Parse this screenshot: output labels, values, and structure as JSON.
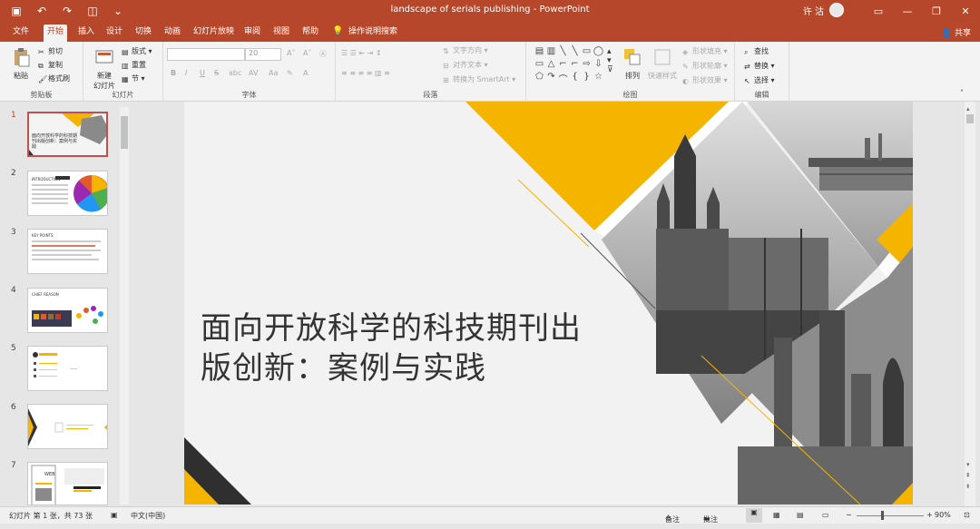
{
  "window": {
    "title": "landscape of serials publishing  -  PowerPoint",
    "user": "许 沽",
    "qat": [
      "save-icon",
      "undo-icon",
      "redo-icon",
      "present-icon",
      "more-icon"
    ]
  },
  "tabs": [
    {
      "label": "文件"
    },
    {
      "label": "开始"
    },
    {
      "label": "插入"
    },
    {
      "label": "设计"
    },
    {
      "label": "切换"
    },
    {
      "label": "动画"
    },
    {
      "label": "幻灯片放映"
    },
    {
      "label": "审阅"
    },
    {
      "label": "视图"
    },
    {
      "label": "帮助"
    },
    {
      "label": "操作说明搜索"
    }
  ],
  "active_tab": "开始",
  "share_label": "共享",
  "ribbon": {
    "clipboard": {
      "paste": "粘贴",
      "cut": "剪切",
      "copy": "复制",
      "format_painter": "格式刷",
      "label": "剪贴板"
    },
    "slides": {
      "new_slide": "新建",
      "new_slide2": "幻灯片",
      "layout": "版式",
      "reset": "重置",
      "section": "节",
      "label": "幻灯片"
    },
    "font": {
      "size": "20",
      "label": "字体",
      "bold": "B",
      "italic": "I",
      "underline": "U",
      "strike": "S",
      "spacing": "AV",
      "case": "Aa",
      "color": "A"
    },
    "paragraph": {
      "text_direction": "文字方向",
      "align_text": "对齐文本",
      "smartart": "转换为 SmartArt",
      "label": "段落"
    },
    "drawing": {
      "arrange": "排列",
      "quick_styles": "快速样式",
      "shape_fill": "形状填充",
      "shape_outline": "形状轮廓",
      "shape_effects": "形状效果",
      "label": "绘图"
    },
    "editing": {
      "find": "查找",
      "replace": "替换",
      "select": "选择",
      "label": "编辑"
    }
  },
  "thumbnails": [
    {
      "num": "1"
    },
    {
      "num": "2"
    },
    {
      "num": "3"
    },
    {
      "num": "4"
    },
    {
      "num": "5"
    },
    {
      "num": "6"
    },
    {
      "num": "7"
    }
  ],
  "thumb_texts": {
    "s1": "面向开放科学的科技期刊出版创新：案例与实践",
    "s2": "INTRODUCTION",
    "s3": "KEY POINTS",
    "s4": "CHIEF REASON",
    "s7": "WEB"
  },
  "slide": {
    "title_line1": "面向开放科学的科技期刊出",
    "title_line2": "版创新：案例与实践"
  },
  "status": {
    "slide_info": "幻灯片 第 1 张，共 73 张",
    "language": "中文(中国)",
    "notes": "备注",
    "comments": "批注",
    "zoom": "90%"
  },
  "colors": {
    "brand": "#b7472a",
    "accent": "#f5b400"
  }
}
